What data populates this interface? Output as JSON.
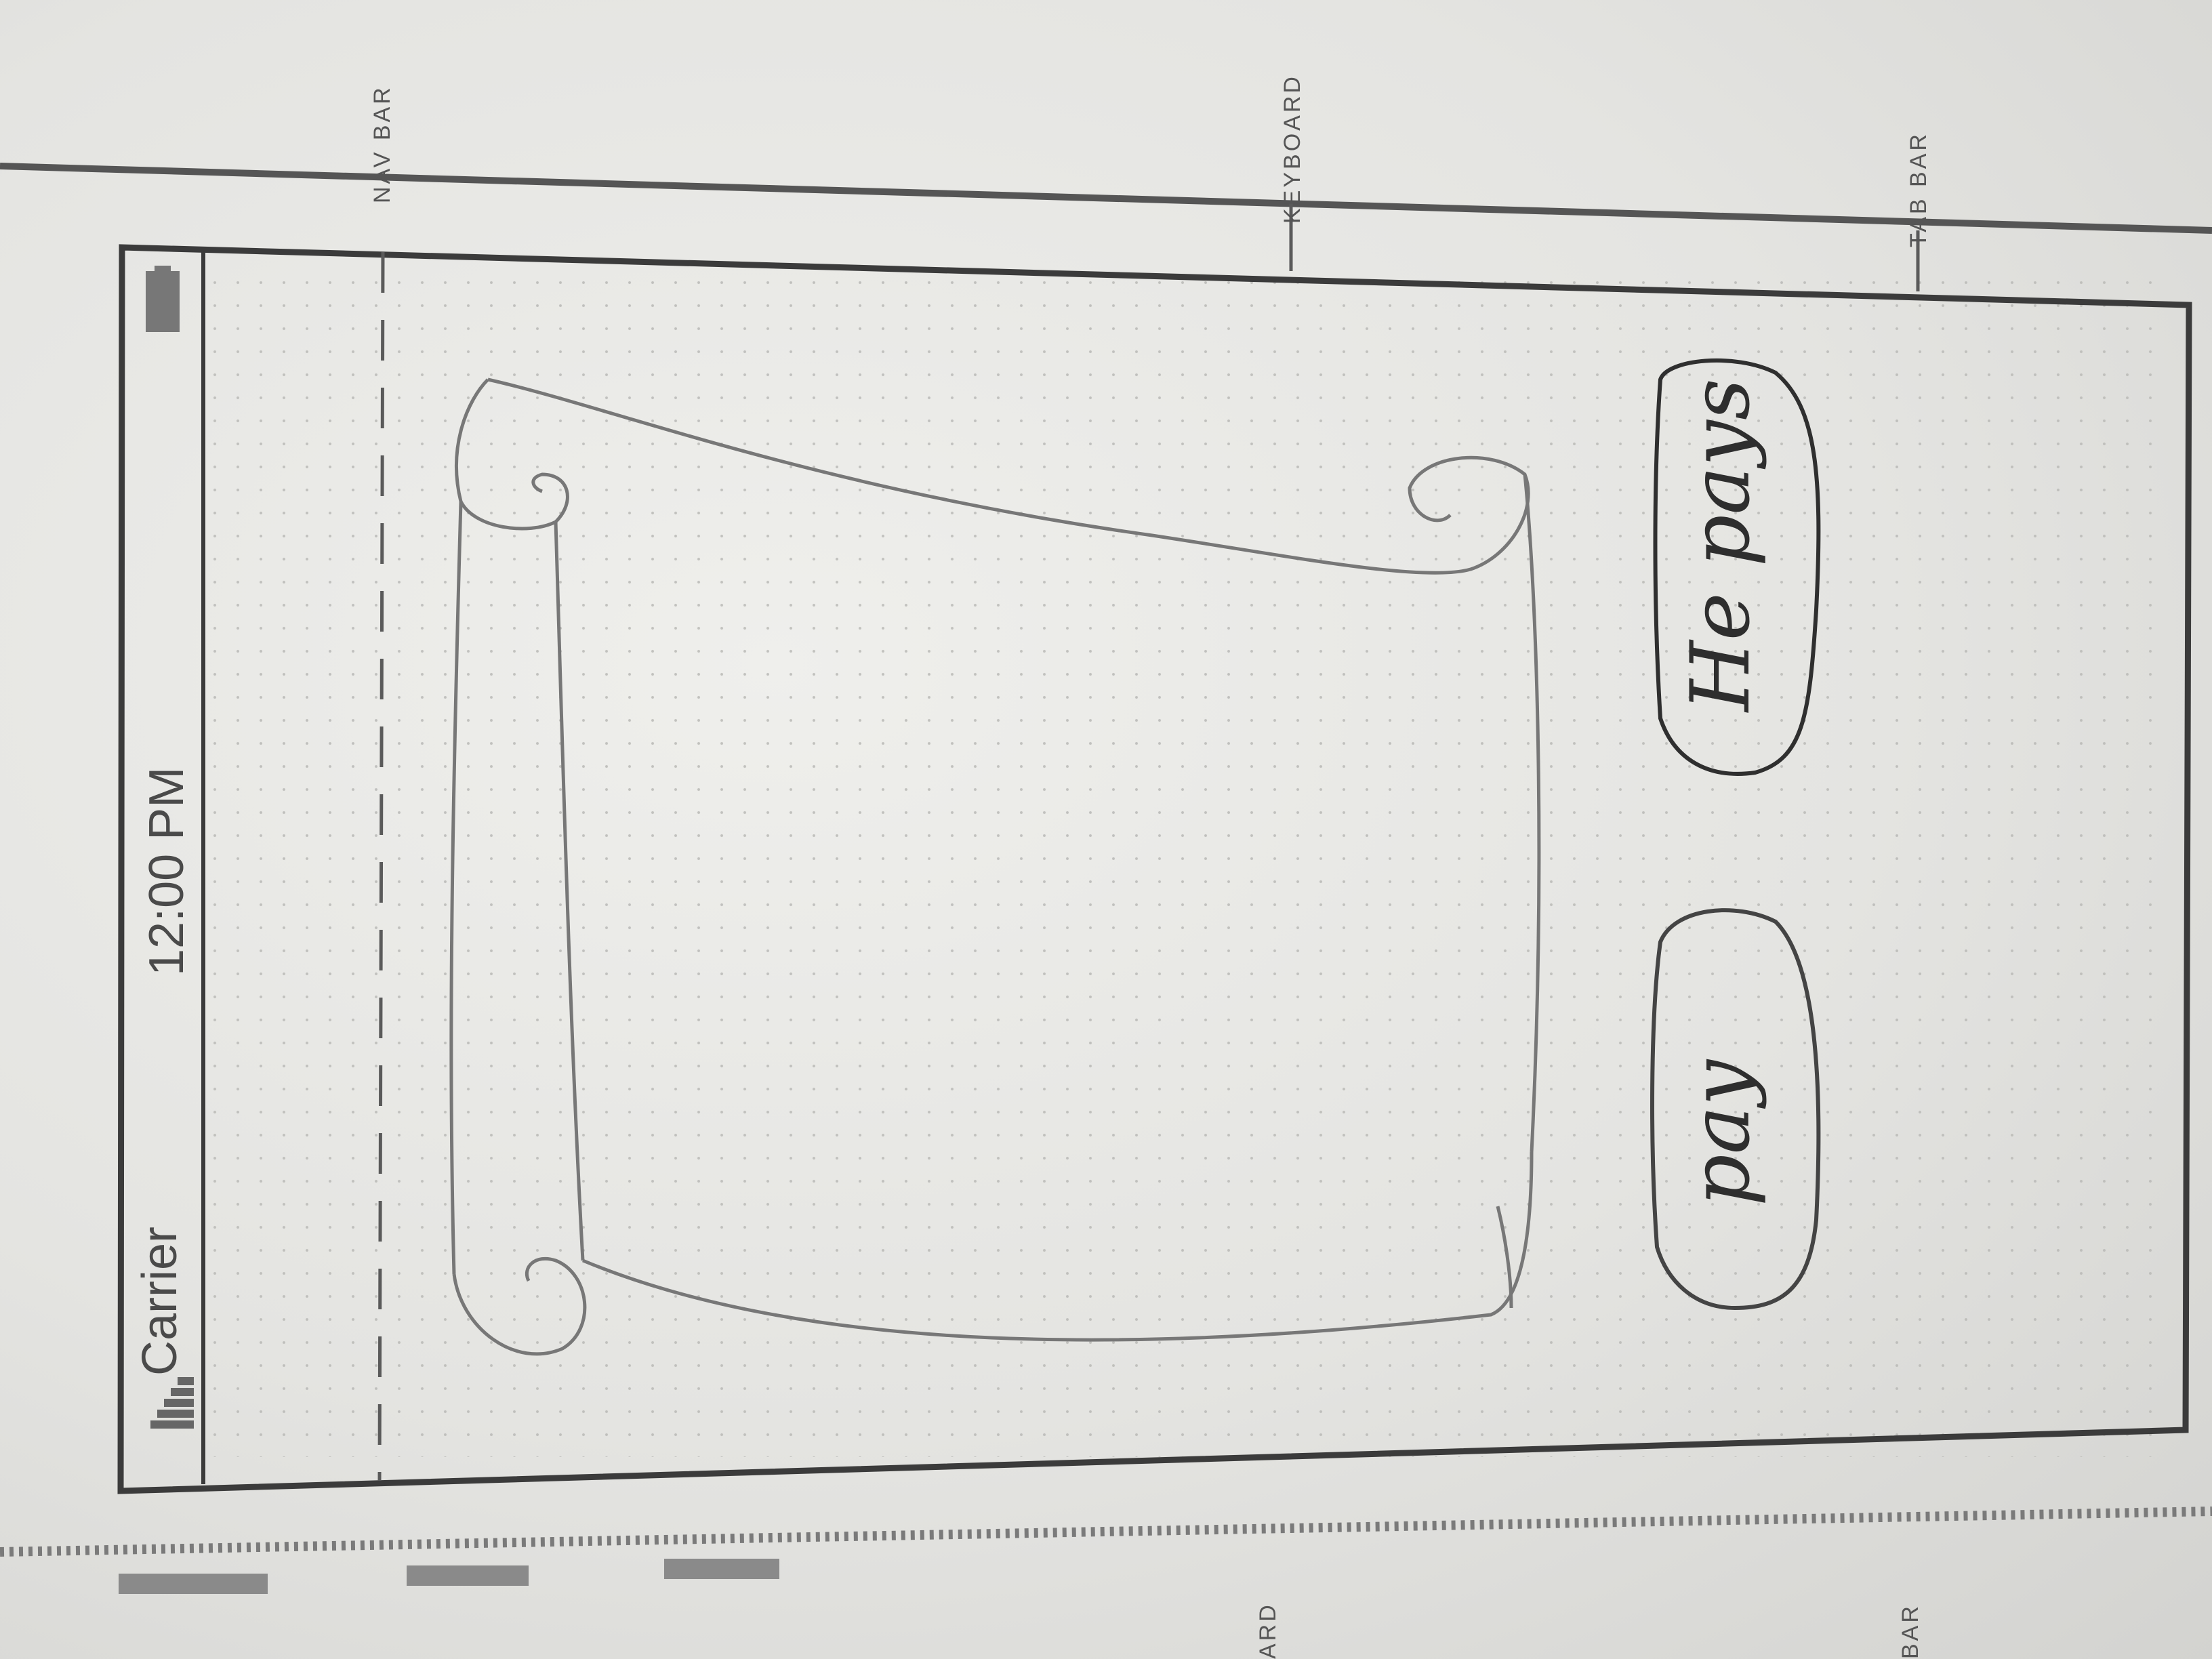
{
  "guides": {
    "nav_bar": "NAV BAR",
    "keyboard": "KEYBOARD",
    "tab_bar": "TAB BAR",
    "keyboard_cut": "ARD",
    "tab_bar_cut": "BAR"
  },
  "status_bar": {
    "carrier": "Carrier",
    "time": "12:00 PM",
    "icons": [
      "signal-icon",
      "battery-icon"
    ]
  },
  "sketch": {
    "scroll_graphic": "scroll-icon",
    "buttons": {
      "pay": "pay",
      "he_pays": "He pays"
    }
  }
}
